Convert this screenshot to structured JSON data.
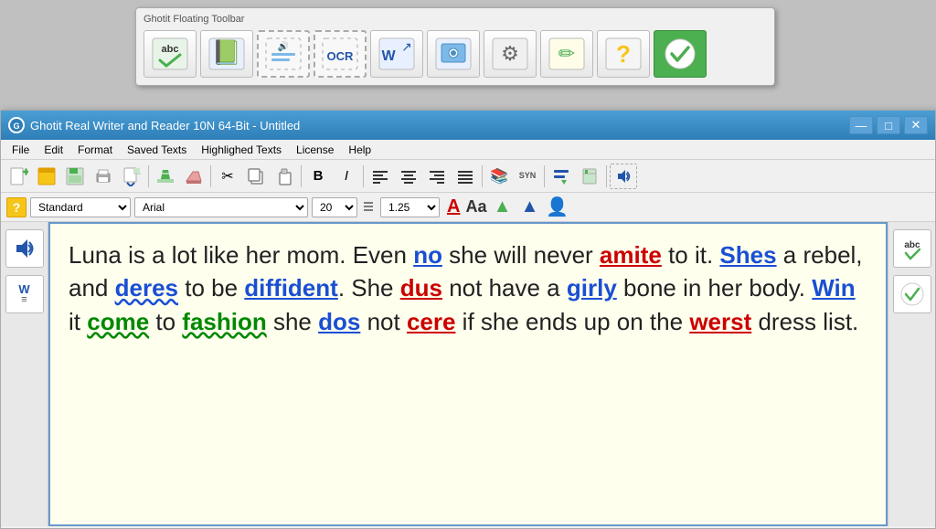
{
  "floating_toolbar": {
    "title": "Ghotit Floating Toolbar",
    "buttons": [
      {
        "name": "spell-check-btn",
        "icon": "abc✓",
        "label": "Spell Check",
        "type": "normal"
      },
      {
        "name": "read-btn",
        "icon": "📖",
        "label": "Read",
        "type": "normal"
      },
      {
        "name": "speak-selection-btn",
        "icon": "🔊",
        "label": "Speak Selection",
        "type": "dashed"
      },
      {
        "name": "ocr-btn",
        "icon": "OCR",
        "label": "OCR",
        "type": "dashed"
      },
      {
        "name": "open-word-btn",
        "icon": "W↗",
        "label": "Open in Word",
        "type": "normal"
      },
      {
        "name": "screenshot-btn",
        "icon": "📸",
        "label": "Screenshot",
        "type": "normal"
      },
      {
        "name": "settings-btn",
        "icon": "⚙",
        "label": "Settings",
        "type": "normal"
      },
      {
        "name": "edit-btn",
        "icon": "✏",
        "label": "Edit",
        "type": "normal"
      },
      {
        "name": "help-btn-ft",
        "icon": "?",
        "label": "Help",
        "type": "normal"
      },
      {
        "name": "check-btn",
        "icon": "✓",
        "label": "Check",
        "type": "active"
      }
    ]
  },
  "main_window": {
    "title": "Ghotit Real Writer and Reader 10N 64-Bit  -  Untitled",
    "icon": "G",
    "controls": {
      "minimize": "—",
      "maximize": "□",
      "close": "✕"
    }
  },
  "menu": {
    "items": [
      "File",
      "Edit",
      "Format",
      "Saved Texts",
      "Highlighed Texts",
      "License",
      "Help"
    ]
  },
  "toolbar": {
    "buttons": [
      {
        "name": "new-btn",
        "icon": "➕",
        "label": "New"
      },
      {
        "name": "open-recent-btn",
        "icon": "📄",
        "label": "Open Recent"
      },
      {
        "name": "save-btn",
        "icon": "💾",
        "label": "Save"
      },
      {
        "name": "print-btn",
        "icon": "🖨",
        "label": "Print"
      },
      {
        "name": "export-btn",
        "icon": "📤",
        "label": "Export"
      },
      {
        "name": "highlight-btn",
        "icon": "🖌",
        "label": "Highlight"
      },
      {
        "name": "erase-btn",
        "icon": "🖊",
        "label": "Erase"
      },
      {
        "name": "cut-btn",
        "icon": "✂",
        "label": "Cut"
      },
      {
        "name": "copy-btn",
        "icon": "📋",
        "label": "Copy"
      },
      {
        "name": "paste-btn",
        "icon": "📎",
        "label": "Paste"
      },
      {
        "name": "bold-btn",
        "icon": "B",
        "label": "Bold"
      },
      {
        "name": "italic-btn",
        "icon": "I",
        "label": "Italic"
      },
      {
        "name": "align-left-btn",
        "icon": "≡",
        "label": "Align Left"
      },
      {
        "name": "align-center-btn",
        "icon": "≡",
        "label": "Align Center"
      },
      {
        "name": "align-right-btn",
        "icon": "≡",
        "label": "Align Right"
      },
      {
        "name": "align-justify-btn",
        "icon": "≡",
        "label": "Justify"
      },
      {
        "name": "thesaurus-btn",
        "icon": "📚",
        "label": "Thesaurus"
      },
      {
        "name": "syn-btn",
        "icon": "SYN",
        "label": "Synonyms"
      },
      {
        "name": "predict-btn",
        "icon": "⬇",
        "label": "Predict"
      },
      {
        "name": "dictionary-btn",
        "icon": "📖",
        "label": "Dictionary"
      },
      {
        "name": "speak-btn",
        "icon": "🔊",
        "label": "Speak"
      }
    ]
  },
  "format_bar": {
    "help_label": "?",
    "style_options": [
      "Standard"
    ],
    "style_value": "Standard",
    "font_options": [
      "Arial"
    ],
    "font_value": "Arial",
    "size_options": [
      "20"
    ],
    "size_value": "20",
    "spacing_options": [
      "1.25"
    ],
    "spacing_value": "1.25",
    "color_A": "A",
    "color_Aa": "Aa"
  },
  "left_sidebar": {
    "buttons": [
      {
        "name": "speak-sidebar-btn",
        "icon": "🔊",
        "label": "Speak"
      },
      {
        "name": "word-prediction-btn",
        "icon": "W≡",
        "label": "Word Prediction"
      }
    ]
  },
  "right_sidebar": {
    "buttons": [
      {
        "name": "abc-check-btn",
        "icon": "abc✓",
        "label": "ABC Check"
      },
      {
        "name": "approve-btn",
        "icon": "✓",
        "label": "Approve"
      }
    ]
  },
  "editor": {
    "content_plain": "Luna is a lot like her mom. Even no she will never amite to it. Shes a rebel, and deres to be diffident. She dus not have a girly bone in her body. Win it come to fashion she dos not cere if she ends up on the werst dress list."
  },
  "colors": {
    "accent_blue": "#2e7db8",
    "title_bar": "#4a9fd4",
    "editor_bg": "#ffffee",
    "editor_border": "#6699cc"
  }
}
